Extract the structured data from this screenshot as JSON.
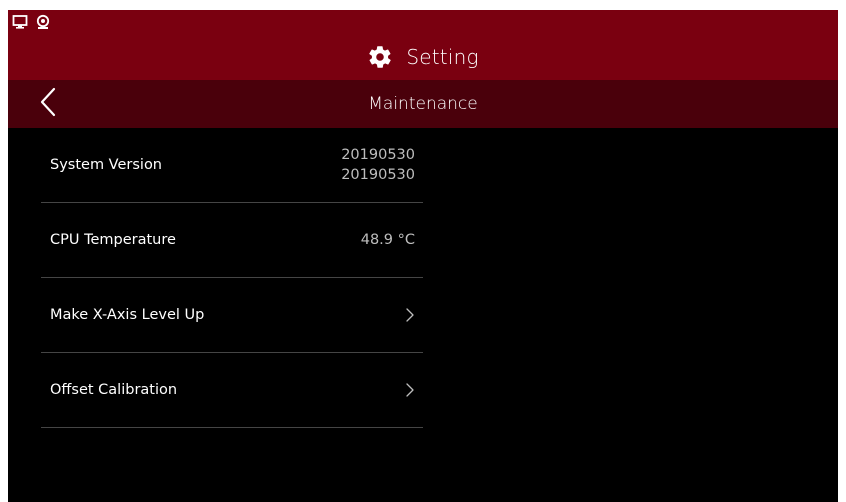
{
  "status_bar": {
    "icons": [
      "monitor-icon",
      "webcam-icon"
    ]
  },
  "header": {
    "icon": "gear-icon",
    "title": "Setting"
  },
  "subheader": {
    "back_icon": "chevron-left-icon",
    "title": "Maintenance"
  },
  "maintenance": {
    "system_version": {
      "label": "System Version",
      "value_line1": "20190530",
      "value_line2": "20190530"
    },
    "cpu_temperature": {
      "label": "CPU Temperature",
      "value": "48.9 °C"
    },
    "x_axis_level": {
      "label": "Make X-Axis Level Up",
      "icon": "chevron-right-icon"
    },
    "offset_calibration": {
      "label": "Offset Calibration",
      "icon": "chevron-right-icon"
    }
  },
  "colors": {
    "header_bg": "#7a0010",
    "subheader_bg": "#4a000b",
    "body_bg": "#000000",
    "divider": "#454545"
  }
}
